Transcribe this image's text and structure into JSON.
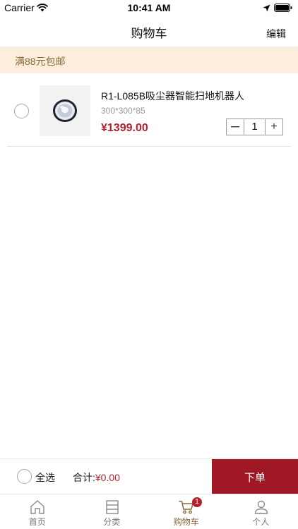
{
  "status_bar": {
    "carrier": "Carrier",
    "time": "10:41 AM",
    "icons": [
      "wifi-icon",
      "location-arrow-icon",
      "battery-icon"
    ]
  },
  "nav": {
    "title": "购物车",
    "edit_label": "编辑"
  },
  "notice": {
    "text": "满88元包邮",
    "background": "#fbeedd",
    "color": "#8a6a3a"
  },
  "cart_items": [
    {
      "name": "R1-L085B吸尘器智能扫地机器人",
      "spec": "300*300*85",
      "price": "¥1399.00",
      "quantity": "1",
      "decrement_label": "—",
      "increment_label": "+",
      "selected": false,
      "thumbnail_icon": "robot-vacuum-icon"
    }
  ],
  "checkout": {
    "select_all_label": "全选",
    "total_label": "合计:",
    "total_value": "¥0.00",
    "order_label": "下单",
    "accent": "#a01825"
  },
  "tabs": [
    {
      "label": "首页",
      "icon": "home-icon",
      "active": false
    },
    {
      "label": "分类",
      "icon": "category-icon",
      "active": false
    },
    {
      "label": "购物车",
      "icon": "cart-icon",
      "active": true,
      "badge": "1"
    },
    {
      "label": "个人",
      "icon": "person-icon",
      "active": false
    }
  ],
  "colors": {
    "price": "#b3202e",
    "active_tab": "#8a6a3a"
  }
}
